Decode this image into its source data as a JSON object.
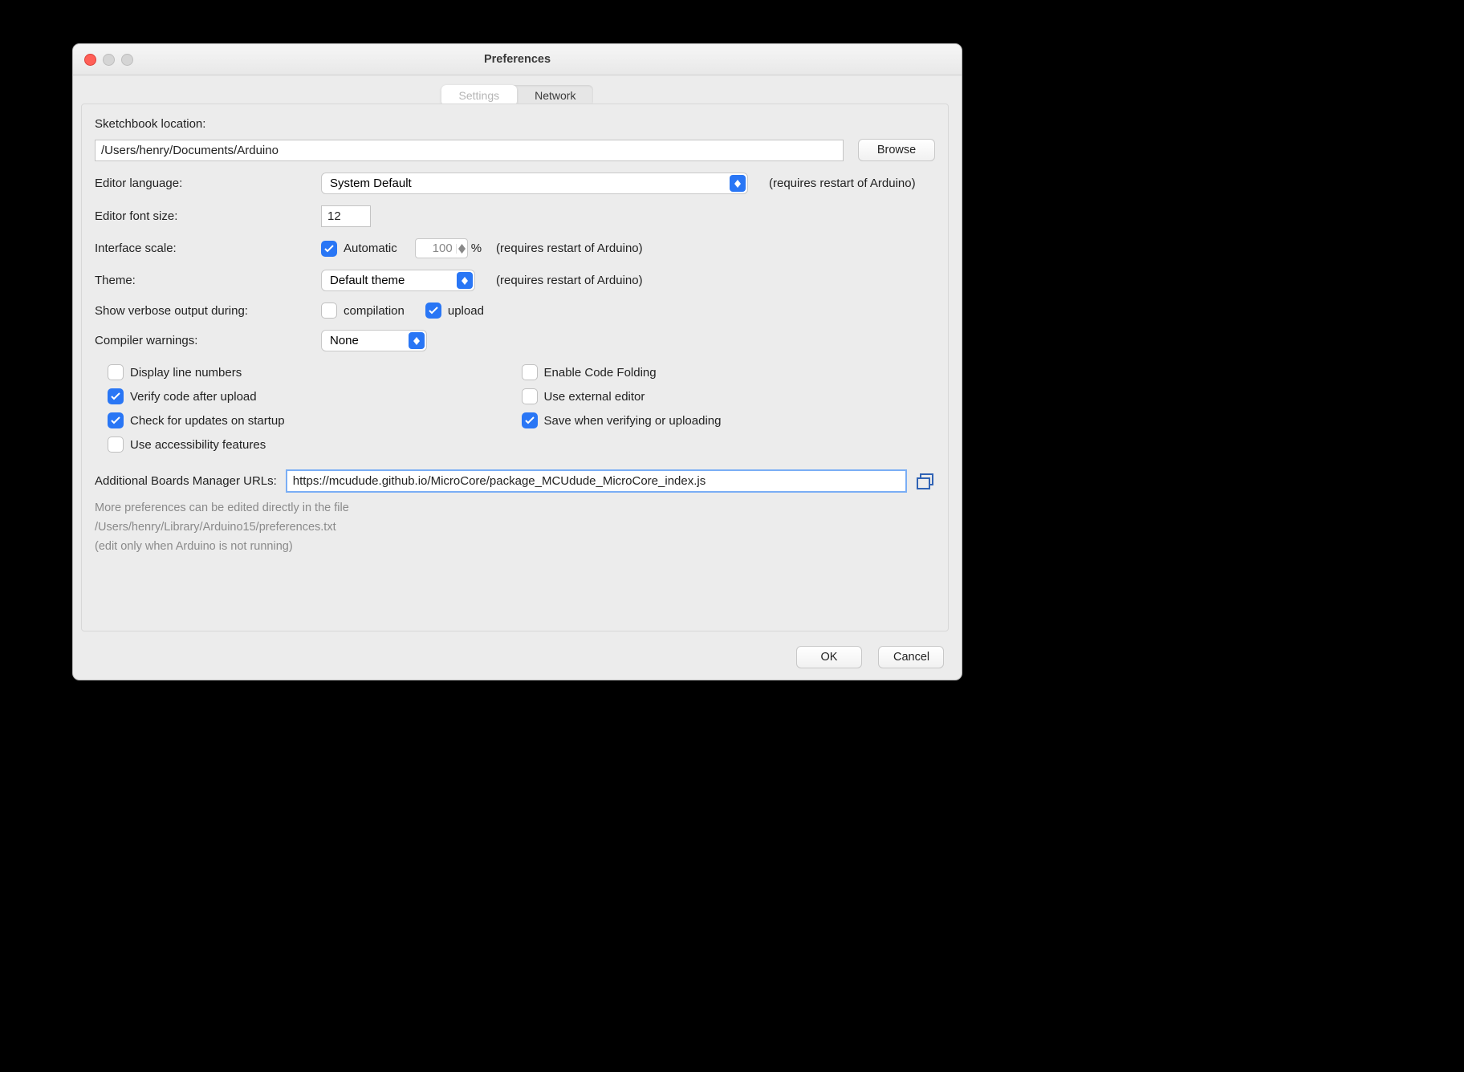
{
  "window": {
    "title": "Preferences"
  },
  "tabs": {
    "settings": "Settings",
    "network": "Network"
  },
  "sketchbook": {
    "label": "Sketchbook location:",
    "value": "/Users/henry/Documents/Arduino",
    "browse": "Browse"
  },
  "editor_language": {
    "label": "Editor language:",
    "value": "System Default",
    "note": "(requires restart of Arduino)"
  },
  "font_size": {
    "label": "Editor font size:",
    "value": "12"
  },
  "interface_scale": {
    "label": "Interface scale:",
    "auto_checked": true,
    "auto_label": "Automatic",
    "value": "100",
    "percent": "%",
    "note": "(requires restart of Arduino)"
  },
  "theme": {
    "label": "Theme:",
    "value": "Default theme",
    "note": "(requires restart of Arduino)"
  },
  "verbose": {
    "label": "Show verbose output during:",
    "compilation_checked": false,
    "compilation_label": "compilation",
    "upload_checked": true,
    "upload_label": "upload"
  },
  "compiler_warnings": {
    "label": "Compiler warnings:",
    "value": "None"
  },
  "options": {
    "line_numbers": {
      "checked": false,
      "label": "Display line numbers"
    },
    "code_folding": {
      "checked": false,
      "label": "Enable Code Folding"
    },
    "verify_upload": {
      "checked": true,
      "label": "Verify code after upload"
    },
    "external_editor": {
      "checked": false,
      "label": "Use external editor"
    },
    "check_updates": {
      "checked": true,
      "label": "Check for updates on startup"
    },
    "save_verify": {
      "checked": true,
      "label": "Save when verifying or uploading"
    },
    "accessibility": {
      "checked": false,
      "label": "Use accessibility features"
    }
  },
  "boards_urls": {
    "label": "Additional Boards Manager URLs:",
    "value": "https://mcudude.github.io/MicroCore/package_MCUdude_MicroCore_index.js"
  },
  "footer_info": {
    "line1": "More preferences can be edited directly in the file",
    "line2": "/Users/henry/Library/Arduino15/preferences.txt",
    "line3": "(edit only when Arduino is not running)"
  },
  "buttons": {
    "ok": "OK",
    "cancel": "Cancel"
  }
}
